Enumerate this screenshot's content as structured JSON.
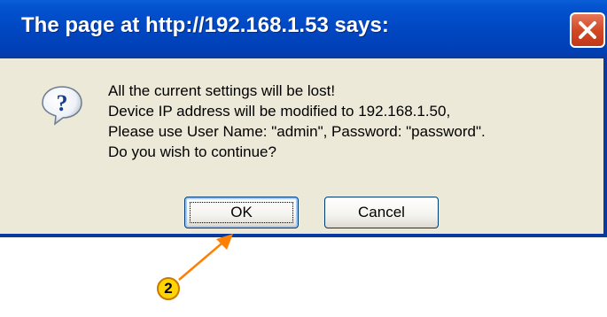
{
  "dialog": {
    "title": "The page at http://192.168.1.53 says:",
    "close_icon": "close-icon",
    "question_icon": "question-icon",
    "message_lines": [
      "All the current settings will be lost!",
      "Device IP address will be modified to 192.168.1.50,",
      "Please use User Name: \"admin\", Password: \"password\".",
      "Do you wish to continue?"
    ],
    "ok_label": "OK",
    "cancel_label": "Cancel"
  },
  "annotation": {
    "callout_number": "2",
    "arrow_color": "#ff7f00"
  }
}
